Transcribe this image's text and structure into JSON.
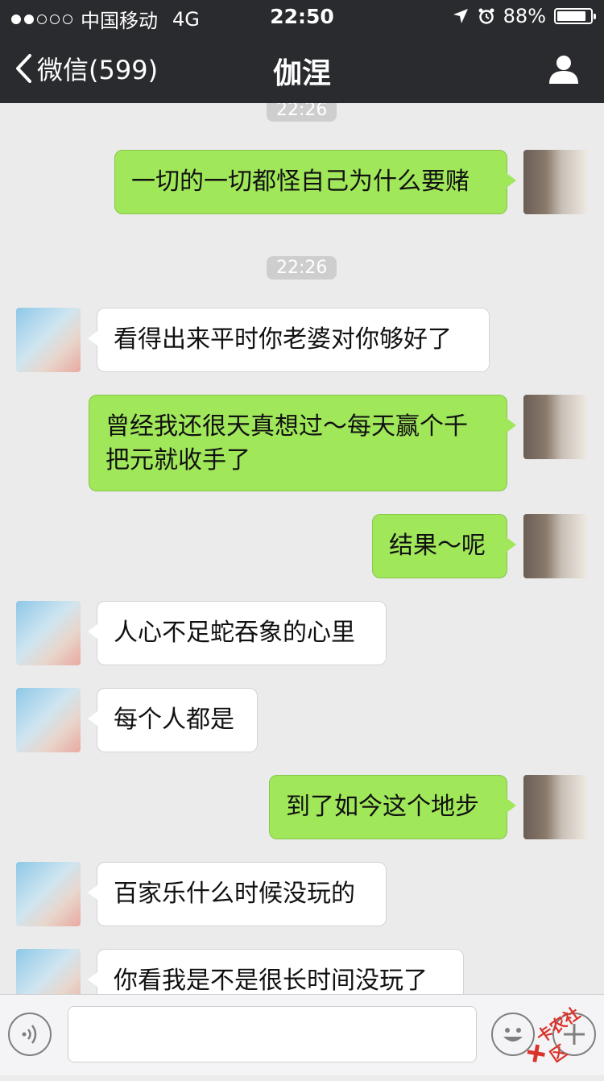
{
  "status_bar": {
    "carrier": "中国移动",
    "network": "4G",
    "time": "22:50",
    "battery_percent": "88%",
    "battery_level": 0.88,
    "signal_bars": 2
  },
  "nav": {
    "back_label": "微信(599)",
    "title": "伽涅"
  },
  "chat": {
    "timestamps": [
      "22:26",
      "22:26"
    ],
    "messages": [
      {
        "from": "me",
        "text": "一切的一切都怪自己为什么要赌"
      },
      {
        "from": "her",
        "text": "看得出来平时你老婆对你够好了"
      },
      {
        "from": "me",
        "text": "曾经我还很天真想过～每天赢个千把元就收手了"
      },
      {
        "from": "me",
        "text": "结果～呢"
      },
      {
        "from": "her",
        "text": "人心不足蛇吞象的心里"
      },
      {
        "from": "her",
        "text": "每个人都是"
      },
      {
        "from": "me",
        "text": "到了如今这个地步"
      },
      {
        "from": "her",
        "text": "百家乐什么时候没玩的"
      },
      {
        "from": "her",
        "text": "你看我是不是很长时间没玩了"
      }
    ]
  },
  "input_bar": {
    "icons": [
      "voice-icon",
      "emoji-icon",
      "plus-icon"
    ]
  },
  "watermark": {
    "text": "卡农社区"
  },
  "colors": {
    "topbar": "#2a2b2f",
    "chat_bg": "#ebebeb",
    "my_bubble": "#a0e75a",
    "her_bubble": "#ffffff"
  }
}
